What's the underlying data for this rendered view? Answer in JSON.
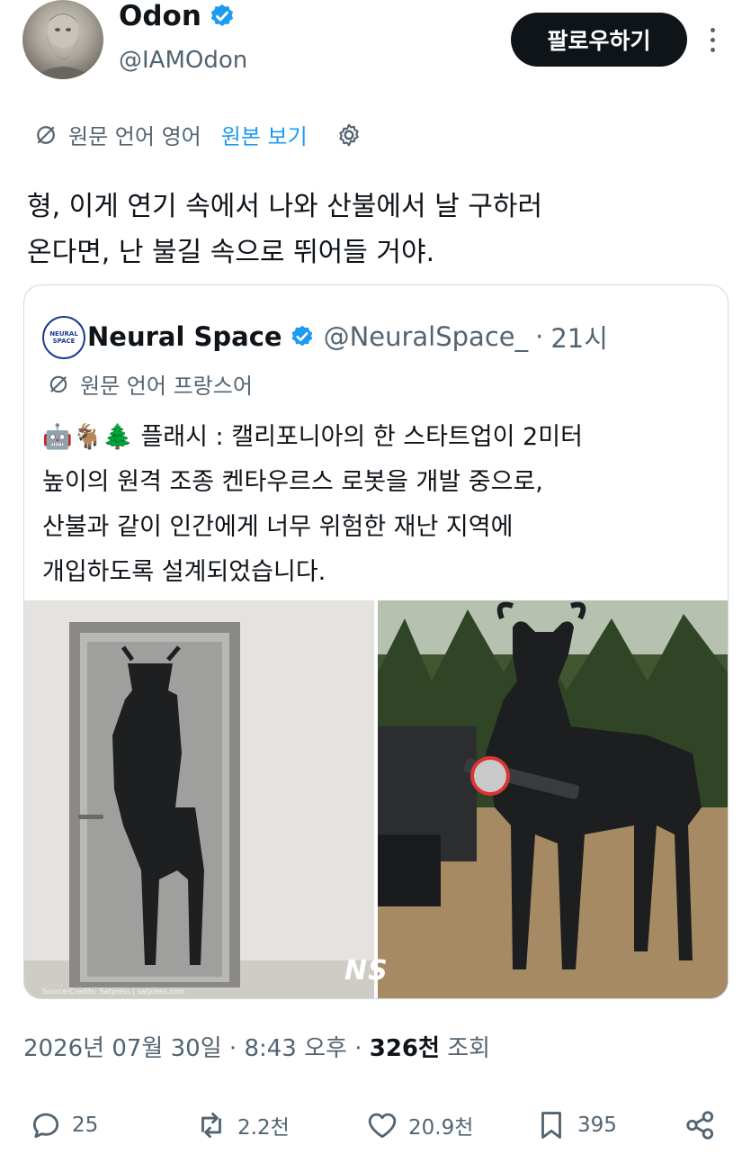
{
  "author": {
    "name": "Odon",
    "handle": "@IAMOdon",
    "verified": true,
    "avatar_icon": "bearded-statue-avatar"
  },
  "follow_label": "팔로우하기",
  "translation": {
    "label": "원문 언어 영어",
    "link": "원본 보기",
    "icon": "translate-icon"
  },
  "tweet_text": "형, 이게 연기 속에서 나와 산불에서 날 구하러\n온다면, 난 불길 속으로 뛰어들 거야.",
  "quote": {
    "avatar_text": "NEURAL SPACE",
    "name": "Neural Space",
    "handle": "@NeuralSpace_",
    "separator": "·",
    "time": "21시",
    "translation_label": "원문 언어 프랑스어",
    "emoji": "🤖🐐🌲",
    "text": " 플래시 : 캘리포니아의 한 스타트업이 2미터\n높이의 원격 조종 켄타우르스 로봇을 개발 중으로,\n산불과 같이 인간에게 너무 위험한 재난 지역에\n개입하도록 설계되었습니다.",
    "watermark": "NS",
    "source_credit": "Source/Credits: Satyress | satyress.com"
  },
  "meta": {
    "date": "2026년 07월 30일",
    "dot": "·",
    "time": "8:43 오후",
    "dot2": "·",
    "views_count": "326천",
    "views_label": "조회"
  },
  "actions": {
    "replies": "25",
    "reposts": "2.2천",
    "likes": "20.9천",
    "bookmarks": "395"
  },
  "colors": {
    "accent": "#1d9bf0",
    "text": "#0f1419",
    "muted": "#536471",
    "border": "#cfd9de"
  }
}
